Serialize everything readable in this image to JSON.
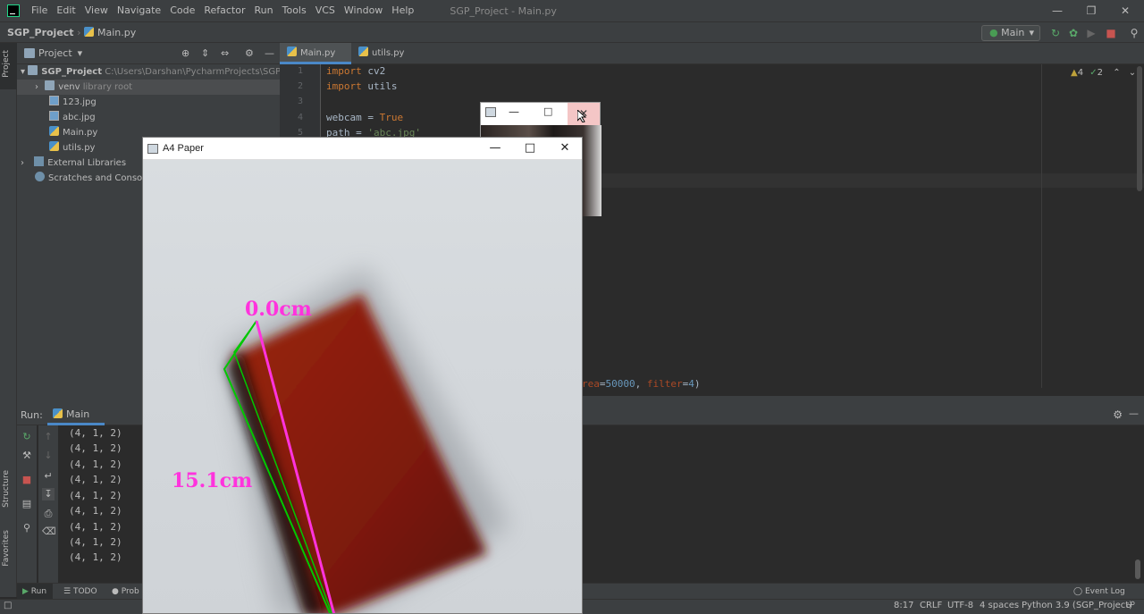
{
  "menu": {
    "items": [
      "File",
      "Edit",
      "View",
      "Navigate",
      "Code",
      "Refactor",
      "Run",
      "Tools",
      "VCS",
      "Window",
      "Help"
    ],
    "window_title": "SGP_Project - Main.py"
  },
  "nav": {
    "project": "SGP_Project",
    "file": "Main.py",
    "run_config": "Main"
  },
  "project_panel": {
    "title": "Project",
    "root": "SGP_Project",
    "root_path": "C:\\Users\\Darshan\\PycharmProjects\\SGP_Proje",
    "venv": "venv",
    "venv_hint": "library root",
    "files": [
      "123.jpg",
      "abc.jpg",
      "Main.py",
      "utils.py"
    ],
    "external": "External Libraries",
    "scratches": "Scratches and Consoles"
  },
  "left_stripe": {
    "project": "Project",
    "structure": "Structure",
    "favorites": "Favorites"
  },
  "editor": {
    "tabs": [
      "Main.py",
      "utils.py"
    ],
    "line_numbers": [
      "1",
      "2",
      "3",
      "4",
      "5"
    ],
    "lines": {
      "l1_kw": "import",
      "l1_rest": " cv2",
      "l2_kw": "import",
      "l2_rest": " utils",
      "l4_var": "webcam = ",
      "l4_val": "True",
      "l5_var": "path = ",
      "l5_val": "'abc.jpg'",
      "partial_prm1": "rea",
      "partial_eq1": "=",
      "partial_num1": "50000",
      "partial_mid": ", ",
      "partial_prm2": "filter",
      "partial_eq2": "=",
      "partial_num2": "4",
      "partial_end": ")"
    },
    "inspections": {
      "warnings": "4",
      "weak_warnings": "2"
    }
  },
  "run_panel": {
    "label": "Run:",
    "tab": "Main",
    "output": [
      "(4, 1, 2)",
      "(4, 1, 2)",
      "(4, 1, 2)",
      "(4, 1, 2)",
      "(4, 1, 2)",
      "(4, 1, 2)",
      "(4, 1, 2)",
      "(4, 1, 2)",
      "(4, 1, 2)"
    ]
  },
  "bottom_tabs": {
    "run": "Run",
    "todo": "TODO",
    "problems": "Prob",
    "event_log": "Event Log"
  },
  "status": {
    "position": "8:17",
    "line_sep": "CRLF",
    "encoding": "UTF-8",
    "indent": "4 spaces",
    "interpreter": "Python 3.9 (SGP_Project)"
  },
  "a4_window": {
    "title": "A4 Paper",
    "measure_top": "0.0cm",
    "measure_left": "15.1cm"
  },
  "colors": {
    "accent": "#4a88c7",
    "measure": "#ff33dd",
    "contour": "#00c800",
    "object": "#8a2010"
  }
}
